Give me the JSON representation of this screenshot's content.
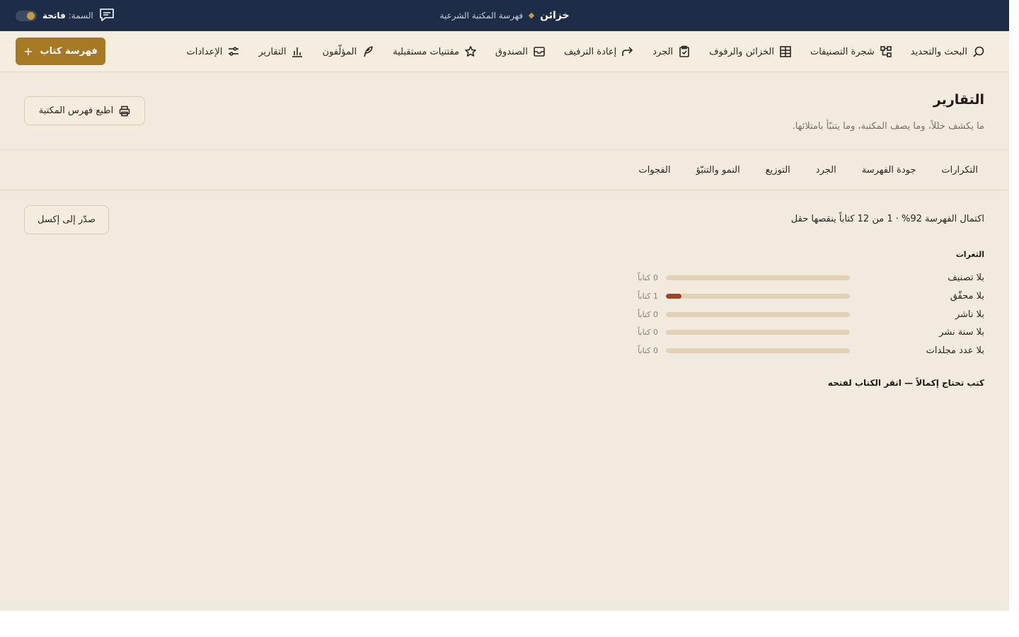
{
  "topbar": {
    "brand_name": "خزائن",
    "brand_subtitle": "فهرسة المكتبة الشرعية",
    "theme_label": "السمة:",
    "theme_value": "فاتحة",
    "icons": {
      "feedback": "chat-icon",
      "toggle": "theme-toggle"
    }
  },
  "nav": {
    "items": [
      {
        "label": "البحث والتحديد",
        "icon": "search-icon"
      },
      {
        "label": "شجرة التصنيفات",
        "icon": "tree-icon"
      },
      {
        "label": "الخزائن والرفوف",
        "icon": "grid-icon"
      },
      {
        "label": "الجرد",
        "icon": "clipboard-icon"
      },
      {
        "label": "إعادة الترفيف",
        "icon": "redo-arrow-icon"
      },
      {
        "label": "الصندوق",
        "icon": "inbox-icon"
      },
      {
        "label": "مقتنيات مستقبلية",
        "icon": "star-icon"
      },
      {
        "label": "المؤلّفون",
        "icon": "quill-icon"
      },
      {
        "label": "التقارير",
        "icon": "bar-chart-icon"
      },
      {
        "label": "الإعدادات",
        "icon": "sliders-icon"
      }
    ],
    "primary_button": "فهرسة كتاب",
    "primary_button_icon": "+"
  },
  "page": {
    "title": "التقارير",
    "subtitle": "ما يكشف خللاً، وما يصف المكتبة، وما يتنبّأ بامتلائها.",
    "print_button": "اطبع فهرس المكتبة"
  },
  "tabs": [
    "التكرارات",
    "جودة الفهرسة",
    "الجرد",
    "التوزيع",
    "النمو والتنبّؤ",
    "الفجوات"
  ],
  "report": {
    "completion_text": "اكتمال الفهرسة 92% · 1 من 12 كتاباً ينقصها حقل",
    "export_button": "صدّر إلى إكسل",
    "gaps_heading": "الثغرات",
    "gaps": [
      {
        "label": "بلا تصنيف",
        "count": 0,
        "count_text": "0 كتاباً"
      },
      {
        "label": "بلا محقّق",
        "count": 1,
        "count_text": "1 كتاباً"
      },
      {
        "label": "بلا ناشر",
        "count": 0,
        "count_text": "0 كتاباً"
      },
      {
        "label": "بلا سنة نشر",
        "count": 0,
        "count_text": "0 كتاباً"
      },
      {
        "label": "بلا عدد مجلدات",
        "count": 0,
        "count_text": "0 كتاباً"
      }
    ],
    "needs_heading": "كتب تحتاج إكمالاً — انقر الكتاب لفتحه"
  },
  "colors": {
    "topbar": "#1e2d47",
    "accent_gold": "#a57a22",
    "page_bg": "#f1ebdf",
    "bar_track": "#e2d2b5",
    "bar_fill": "#9a4428"
  }
}
